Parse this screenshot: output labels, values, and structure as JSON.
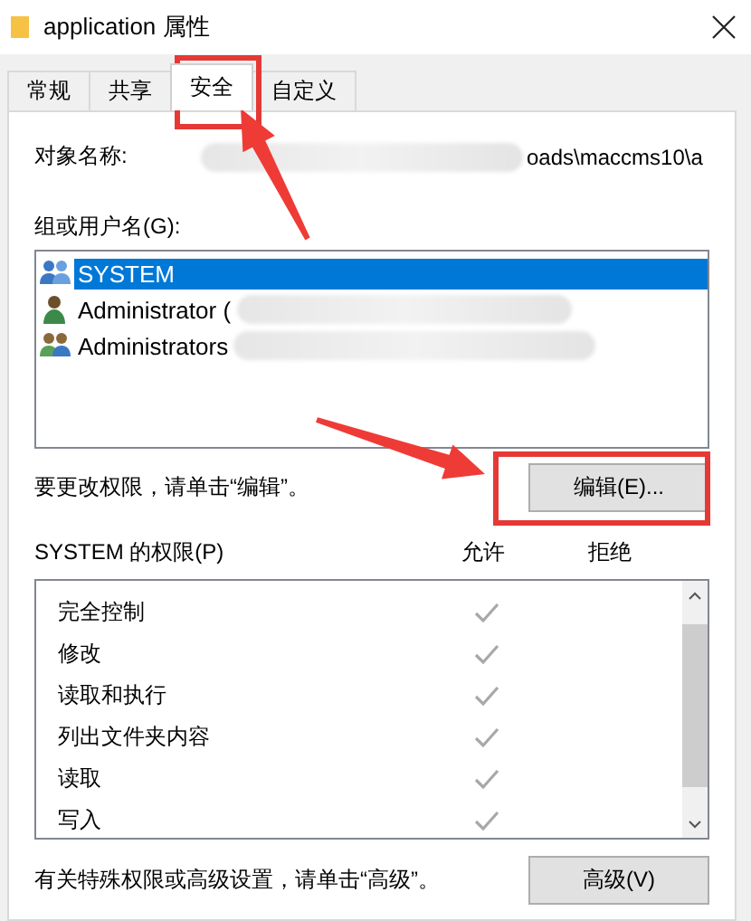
{
  "window": {
    "title": "application 属性"
  },
  "tabs": [
    {
      "label": "常规",
      "selected": false
    },
    {
      "label": "共享",
      "selected": false
    },
    {
      "label": "安全",
      "selected": true
    },
    {
      "label": "自定义",
      "selected": false
    }
  ],
  "object_name": {
    "label": "对象名称:",
    "value": "oads\\maccms10\\a"
  },
  "users": {
    "label": "组或用户名(G):",
    "items": [
      {
        "name": "SYSTEM",
        "kind": "system",
        "selected": true
      },
      {
        "name": "Administrator (",
        "kind": "user",
        "selected": false
      },
      {
        "name": "Administrators",
        "kind": "admins",
        "selected": false
      }
    ]
  },
  "edit_hint": "要更改权限，请单击“编辑”。",
  "edit_button": "编辑(E)...",
  "permissions": {
    "title": "SYSTEM 的权限(P)",
    "columns": [
      "允许",
      "拒绝"
    ],
    "items": [
      {
        "name": "完全控制",
        "allow": true,
        "deny": false
      },
      {
        "name": "修改",
        "allow": true,
        "deny": false
      },
      {
        "name": "读取和执行",
        "allow": true,
        "deny": false
      },
      {
        "name": "列出文件夹内容",
        "allow": true,
        "deny": false
      },
      {
        "name": "读取",
        "allow": true,
        "deny": false
      },
      {
        "name": "写入",
        "allow": true,
        "deny": false
      }
    ]
  },
  "advanced_hint": "有关特殊权限或高级设置，请单击“高级”。",
  "advanced_button": "高级(V)"
}
